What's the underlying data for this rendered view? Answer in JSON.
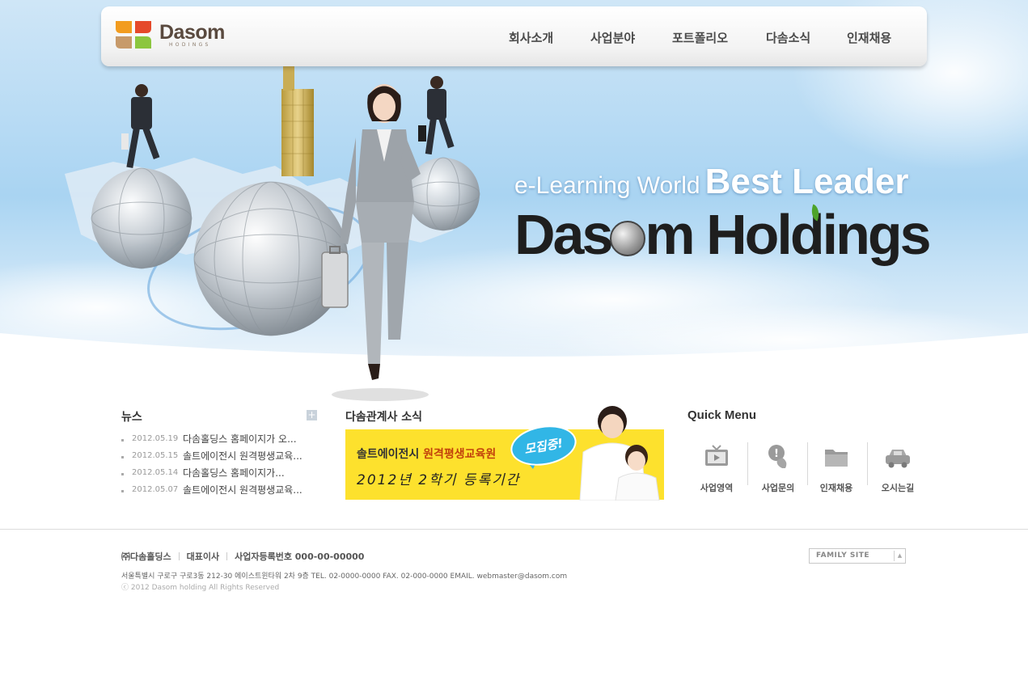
{
  "brand": {
    "logo_name": "Dasom",
    "logo_sub": "HODINGS",
    "logo_colors": [
      "#f29c1f",
      "#8cc63f",
      "#c79a6a",
      "#b6d14a"
    ]
  },
  "nav": {
    "items": [
      "회사소개",
      "사업분야",
      "포트폴리오",
      "다솜소식",
      "인재채용"
    ]
  },
  "hero": {
    "tagline_light": "e-Learning World",
    "tagline_bold": "Best Leader",
    "brand_part1": "Das",
    "brand_part2": "m Holdings"
  },
  "news": {
    "title": "뉴스",
    "more_icon": "plus-icon",
    "items": [
      {
        "date": "2012.05.19",
        "title": "다솜홀딩스 홈페이지가 오..."
      },
      {
        "date": "2012.05.15",
        "title": "솔트에이전시 원격평생교육..."
      },
      {
        "date": "2012.05.14",
        "title": "다솜홀딩스 홈페이지가..."
      },
      {
        "date": "2012.05.07",
        "title": "솔트에이전시 원격평생교육..."
      }
    ]
  },
  "affiliate": {
    "title": "다솜관계사 소식",
    "banner_org": "솔트에이전시",
    "banner_org_hl": "원격평생교육원",
    "banner_period": "2012년 2학기 등록기간",
    "banner_badge": "모집중!"
  },
  "quick_menu": {
    "title": "Quick Menu",
    "items": [
      {
        "label": "사업영역",
        "icon": "tv-icon"
      },
      {
        "label": "사업문의",
        "icon": "phone-icon"
      },
      {
        "label": "인재채용",
        "icon": "folder-icon"
      },
      {
        "label": "오시는길",
        "icon": "car-icon"
      }
    ]
  },
  "footer": {
    "company": "㈜다솜홀딩스",
    "ceo": "대표이사",
    "reg_no": "사업자등록번호 000-00-00000",
    "address": "서울특별시 구로구 구로3동 212-30 에이스트윈타워 2차 9층   TEL. 02-0000-0000   FAX. 02-000-0000   EMAIL. webmaster@dasom.com",
    "copyright": "ⓒ 2012 Dasom holding All Rights Reserved",
    "family_site": "FAMILY SITE"
  }
}
